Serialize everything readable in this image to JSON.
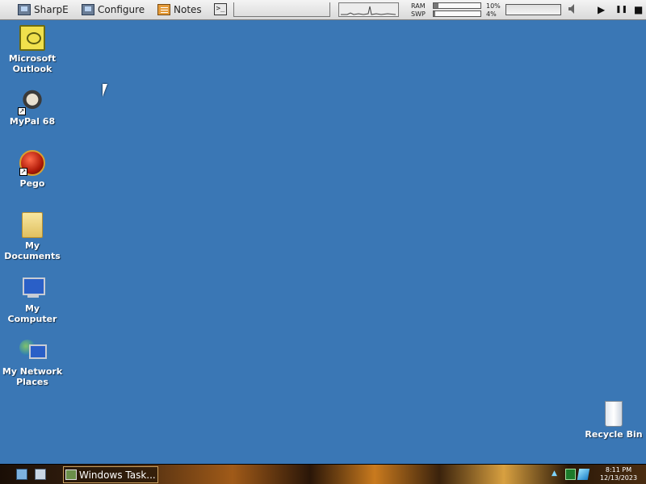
{
  "topbar": {
    "buttons": [
      {
        "label": "SharpE",
        "icon": "monitor-icon"
      },
      {
        "label": "Configure",
        "icon": "monitor-icon"
      },
      {
        "label": "Notes",
        "icon": "notes-icon"
      }
    ],
    "system_monitor": {
      "ram_label": "RAM",
      "swp_label": "SWP",
      "ram_pct": "10%",
      "swp_pct": "4%",
      "ram_fraction": 0.1,
      "swp_fraction": 0.04
    },
    "media": {
      "play": "▶",
      "pause": "❚❚",
      "stop": "■"
    },
    "volume_icon": "speaker-icon"
  },
  "desktop": {
    "icons": [
      {
        "label": "Microsoft Outlook",
        "icon": "outlook-icon"
      },
      {
        "label": "MyPal 68",
        "icon": "mypal-icon",
        "shortcut": true
      },
      {
        "label": "Pego",
        "icon": "pego-icon",
        "shortcut": true
      },
      {
        "label": "My Documents",
        "icon": "folder-icon"
      },
      {
        "label": "My Computer",
        "icon": "computer-icon"
      },
      {
        "label": "My Network Places",
        "icon": "network-icon"
      },
      {
        "label": "Recycle Bin",
        "icon": "recycle-bin-icon"
      }
    ],
    "background_color": "#3a77b5"
  },
  "taskbar": {
    "task_label": "Windows Task...",
    "clock_time": "8:11 PM",
    "clock_date": "12/13/2023"
  }
}
